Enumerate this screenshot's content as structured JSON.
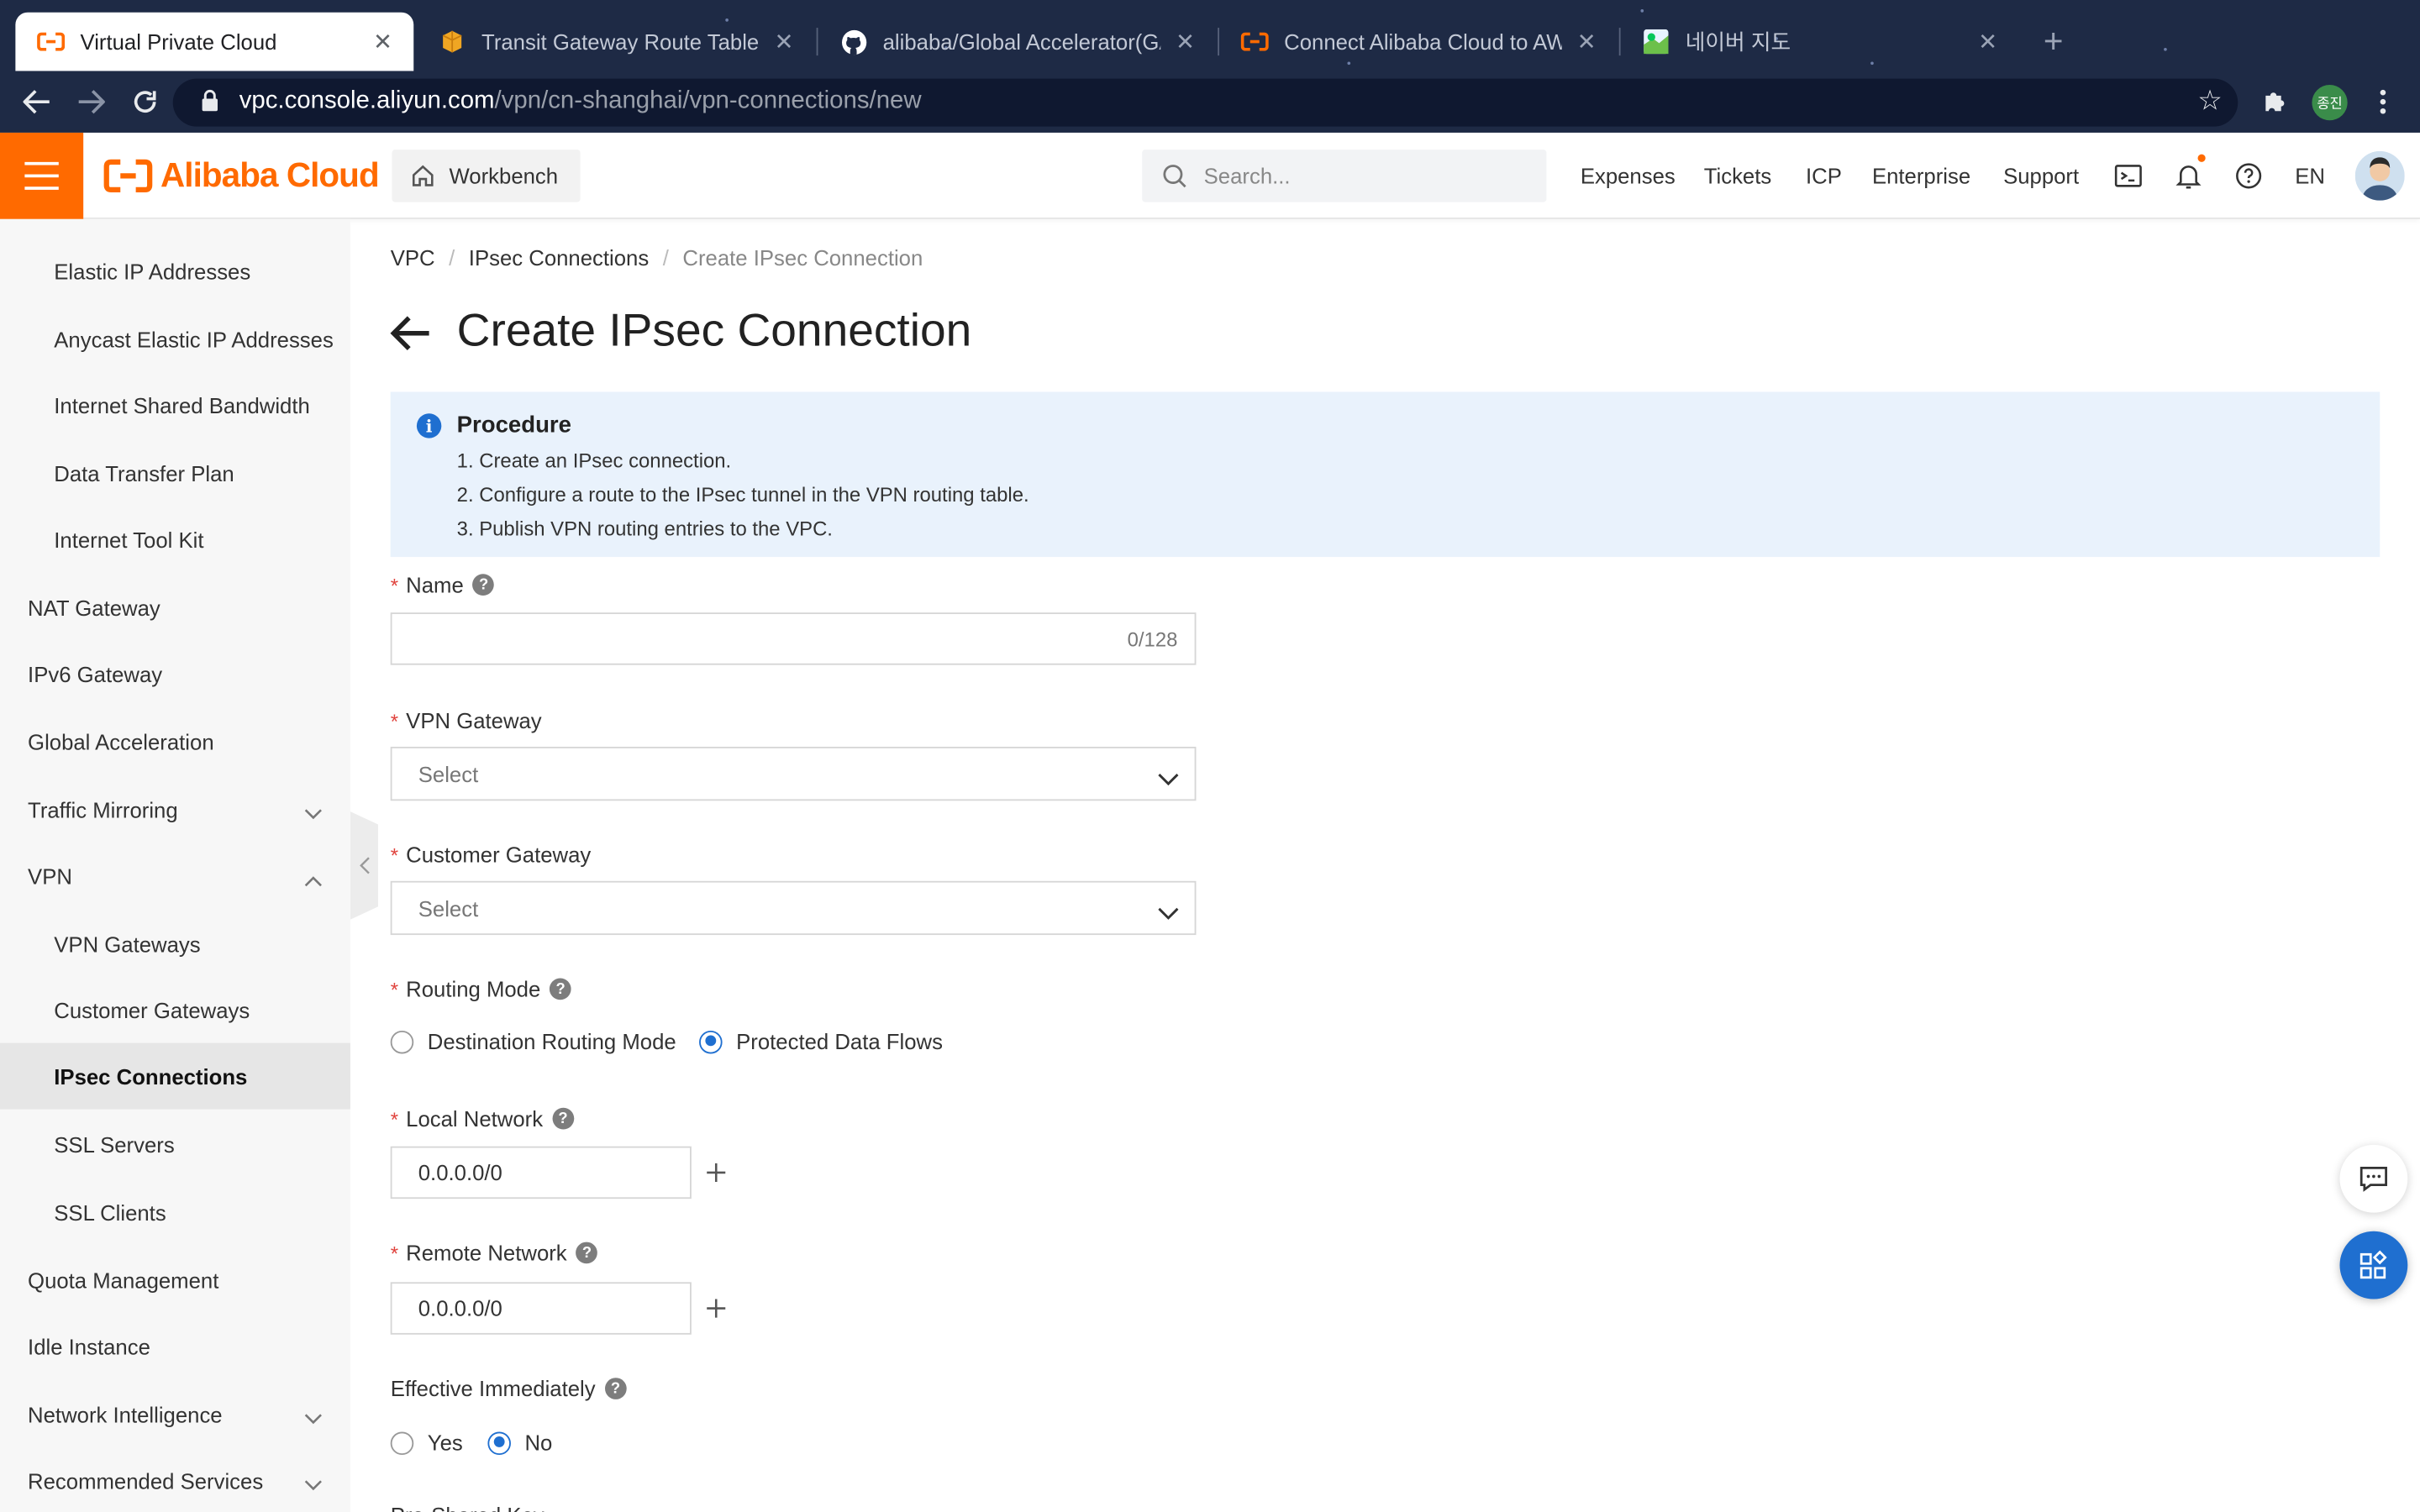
{
  "browser": {
    "tabs": [
      {
        "title": "Virtual Private Cloud",
        "icon": "alibaba-cloud-icon",
        "active": true
      },
      {
        "title": "Transit Gateway Route Tables |",
        "icon": "aws-box-icon",
        "active": false
      },
      {
        "title": "alibaba/Global Accelerator(GA",
        "icon": "github-icon",
        "active": false
      },
      {
        "title": "Connect Alibaba Cloud to AWS",
        "icon": "alibaba-cloud-icon",
        "active": false
      },
      {
        "title": "네이버 지도",
        "icon": "naver-map-icon",
        "active": false
      }
    ],
    "url_host": "vpc.console.aliyun.com",
    "url_path": "/vpn/cn-shanghai/vpn-connections/new",
    "profile_initials": "종진"
  },
  "header": {
    "logo": "Alibaba Cloud",
    "workbench": "Workbench",
    "search_placeholder": "Search...",
    "nav": [
      "Expenses",
      "Tickets",
      "ICP",
      "Enterprise",
      "Support"
    ],
    "lang": "EN",
    "brand_color": "#ff6a00"
  },
  "sidebar": {
    "items": [
      {
        "label": "Elastic IP Addresses",
        "level": "sub"
      },
      {
        "label": "Anycast Elastic IP Addresses",
        "level": "sub"
      },
      {
        "label": "Internet Shared Bandwidth",
        "level": "sub"
      },
      {
        "label": "Data Transfer Plan",
        "level": "sub"
      },
      {
        "label": "Internet Tool Kit",
        "level": "sub"
      },
      {
        "label": "NAT Gateway",
        "level": "top"
      },
      {
        "label": "IPv6 Gateway",
        "level": "top"
      },
      {
        "label": "Global Acceleration",
        "level": "top"
      },
      {
        "label": "Traffic Mirroring",
        "level": "top",
        "chevron": "down"
      },
      {
        "label": "VPN",
        "level": "top",
        "chevron": "up"
      },
      {
        "label": "VPN Gateways",
        "level": "sub"
      },
      {
        "label": "Customer Gateways",
        "level": "sub"
      },
      {
        "label": "IPsec Connections",
        "level": "sub",
        "active": true
      },
      {
        "label": "SSL Servers",
        "level": "sub"
      },
      {
        "label": "SSL Clients",
        "level": "sub"
      },
      {
        "label": "Quota Management",
        "level": "top"
      },
      {
        "label": "Idle Instance",
        "level": "top"
      },
      {
        "label": "Network Intelligence",
        "level": "top",
        "chevron": "down"
      },
      {
        "label": "Recommended Services",
        "level": "top",
        "chevron": "down"
      }
    ]
  },
  "breadcrumb": [
    "VPC",
    "IPsec Connections",
    "Create IPsec Connection"
  ],
  "page_title": "Create IPsec Connection",
  "procedure": {
    "title": "Procedure",
    "steps": [
      "1. Create an IPsec connection.",
      "2. Configure a route to the IPsec tunnel in the VPN routing table.",
      "3. Publish VPN routing entries to the VPC."
    ]
  },
  "form": {
    "name": {
      "label": "Name",
      "value": "",
      "counter": "0/128"
    },
    "vpn_gateway": {
      "label": "VPN Gateway",
      "placeholder": "Select"
    },
    "customer_gateway": {
      "label": "Customer Gateway",
      "placeholder": "Select"
    },
    "routing_mode": {
      "label": "Routing Mode",
      "options": [
        "Destination Routing Mode",
        "Protected Data Flows"
      ],
      "selected": "Protected Data Flows"
    },
    "local_network": {
      "label": "Local Network",
      "value": "0.0.0.0/0"
    },
    "remote_network": {
      "label": "Remote Network",
      "value": "0.0.0.0/0"
    },
    "effective_immediately": {
      "label": "Effective Immediately",
      "options": [
        "Yes",
        "No"
      ],
      "selected": "No"
    },
    "next_label_partial": "Pre-Shared Key"
  },
  "accent_color": "#1f6fd0"
}
